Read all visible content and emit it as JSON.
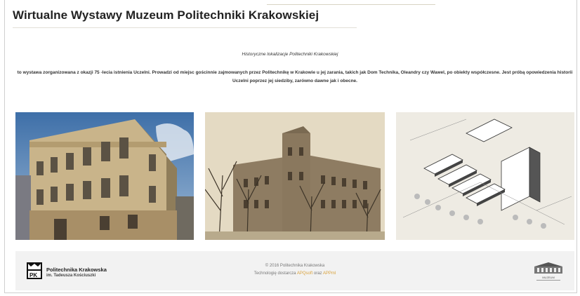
{
  "header": {
    "title": "Wirtualne Wystawy Muzeum Politechniki Krakowskiej"
  },
  "exhibition": {
    "subtitle": "Historyczne lokalizacje Politechniki Krakowskiej",
    "description": "to wystawa zorganizowana z okazji 75 -lecia istnienia Uczelni. Prowadzi od miejsc gościnnie zajmowanych przez Politechnikę w Krakowie u jej zarania, takich jak Dom Technika, Oleandry czy Wawel, po obiekty współczesne. Jest próbą opowiedzenia historii Uczelni poprzez jej siedziby, zarówno dawne jak i obecne."
  },
  "photos": [
    {
      "icon": "historic-townhouse-photo"
    },
    {
      "icon": "old-university-building-photo"
    },
    {
      "icon": "campus-architectural-drawing"
    }
  ],
  "footer": {
    "org_name": "Politechnika Krakowska",
    "org_sub": "im. Tadeusza Kościuszki",
    "copyright": "© 2016 Politechnika Krakowska",
    "tech_prefix": "Technologię dostarcza",
    "tech_link1": "APQsoft",
    "tech_middle": "oraz",
    "tech_link2": "APPml",
    "museum_label": "MUZEUM"
  },
  "colors": {
    "link": "#d9a23c",
    "footer_bg": "#f2f2f2",
    "title": "#222222"
  }
}
